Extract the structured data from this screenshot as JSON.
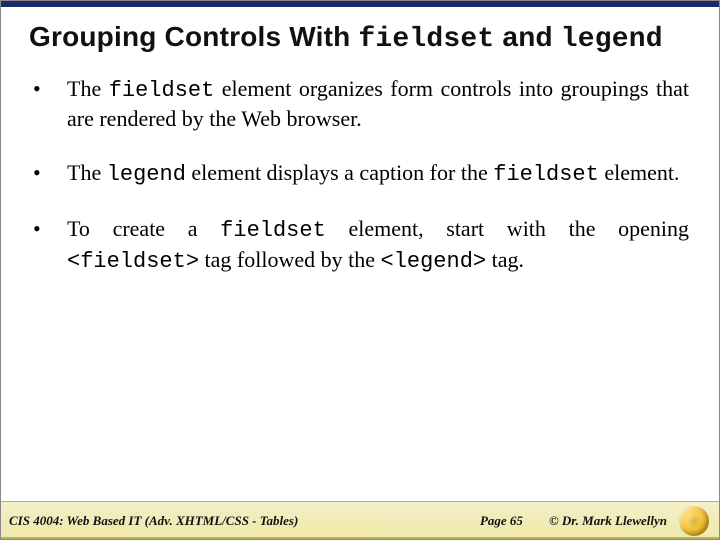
{
  "title": {
    "pre": "Grouping Controls With ",
    "code1": "fieldset",
    "mid": " and ",
    "code2": "legend"
  },
  "bullets": [
    {
      "segments": [
        {
          "t": "The "
        },
        {
          "t": "fieldset",
          "mono": true
        },
        {
          "t": " element organizes form controls into groupings that are rendered by the Web browser."
        }
      ]
    },
    {
      "segments": [
        {
          "t": "The "
        },
        {
          "t": "legend",
          "mono": true
        },
        {
          "t": " element displays a caption for the "
        },
        {
          "t": "fieldset",
          "mono": true
        },
        {
          "t": " element."
        }
      ]
    },
    {
      "segments": [
        {
          "t": "To create a "
        },
        {
          "t": "fieldset",
          "mono": true
        },
        {
          "t": " element, start with the opening "
        },
        {
          "t": "<fieldset>",
          "mono": true
        },
        {
          "t": " tag followed by the "
        },
        {
          "t": "<legend>",
          "mono": true
        },
        {
          "t": " tag."
        }
      ]
    }
  ],
  "footer": {
    "left": "CIS 4004: Web Based IT (Adv. XHTML/CSS - Tables)",
    "mid": "Page 65",
    "right": "© Dr. Mark Llewellyn"
  }
}
